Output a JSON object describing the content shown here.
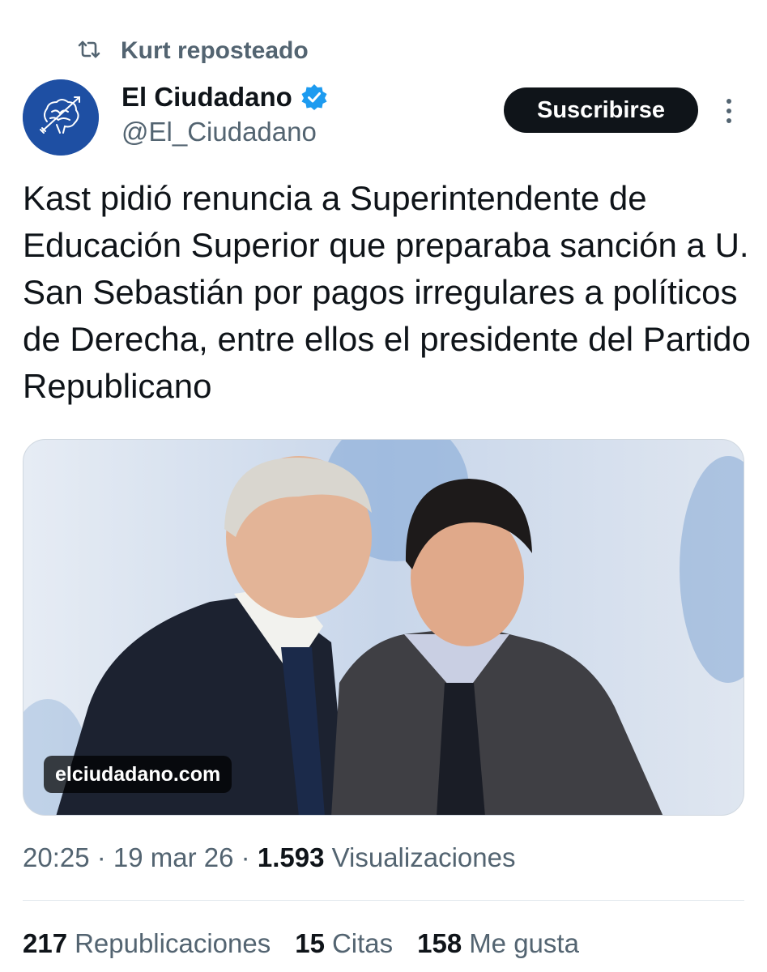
{
  "repost": {
    "icon": "retweet-icon",
    "text": "Kurt reposteado"
  },
  "author": {
    "avatar_icon": "brain-arrow-logo-icon",
    "name": "El Ciudadano",
    "verified_icon": "verified-badge-icon",
    "handle": "@El_Ciudadano"
  },
  "subscribe_label": "Suscribirse",
  "more_icon": "more-vertical-icon",
  "tweet_text": "Kast pidió renuncia a Superintendente de Educación Superior que preparaba sanción a U. San Sebastián por pagos irregulares a políticos de Derecha, entre ellos el presidente del Partido Republicano",
  "media": {
    "source_label": "elciudadano.com"
  },
  "meta": {
    "time": "20:25",
    "sep1": " · ",
    "date": "19 mar 26",
    "sep2": " · ",
    "views": "1.593",
    "views_label": "Visualizaciones"
  },
  "stats": [
    {
      "count": "217",
      "label": "Republicaciones"
    },
    {
      "count": "15",
      "label": "Citas"
    },
    {
      "count": "158",
      "label": "Me gusta"
    }
  ],
  "colors": {
    "accent": "#1d9bf0",
    "text": "#0f1419",
    "muted": "#536471",
    "button": "#0f1419"
  }
}
